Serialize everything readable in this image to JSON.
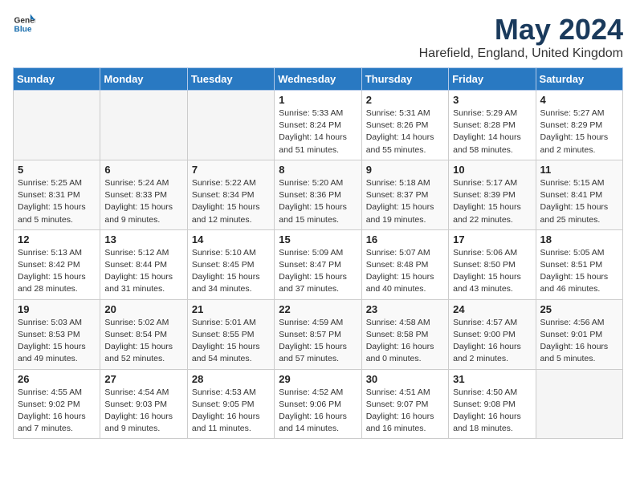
{
  "header": {
    "logo_general": "General",
    "logo_blue": "Blue",
    "month_title": "May 2024",
    "location": "Harefield, England, United Kingdom"
  },
  "weekdays": [
    "Sunday",
    "Monday",
    "Tuesday",
    "Wednesday",
    "Thursday",
    "Friday",
    "Saturday"
  ],
  "weeks": [
    [
      {
        "day": "",
        "info": ""
      },
      {
        "day": "",
        "info": ""
      },
      {
        "day": "",
        "info": ""
      },
      {
        "day": "1",
        "info": "Sunrise: 5:33 AM\nSunset: 8:24 PM\nDaylight: 14 hours\nand 51 minutes."
      },
      {
        "day": "2",
        "info": "Sunrise: 5:31 AM\nSunset: 8:26 PM\nDaylight: 14 hours\nand 55 minutes."
      },
      {
        "day": "3",
        "info": "Sunrise: 5:29 AM\nSunset: 8:28 PM\nDaylight: 14 hours\nand 58 minutes."
      },
      {
        "day": "4",
        "info": "Sunrise: 5:27 AM\nSunset: 8:29 PM\nDaylight: 15 hours\nand 2 minutes."
      }
    ],
    [
      {
        "day": "5",
        "info": "Sunrise: 5:25 AM\nSunset: 8:31 PM\nDaylight: 15 hours\nand 5 minutes."
      },
      {
        "day": "6",
        "info": "Sunrise: 5:24 AM\nSunset: 8:33 PM\nDaylight: 15 hours\nand 9 minutes."
      },
      {
        "day": "7",
        "info": "Sunrise: 5:22 AM\nSunset: 8:34 PM\nDaylight: 15 hours\nand 12 minutes."
      },
      {
        "day": "8",
        "info": "Sunrise: 5:20 AM\nSunset: 8:36 PM\nDaylight: 15 hours\nand 15 minutes."
      },
      {
        "day": "9",
        "info": "Sunrise: 5:18 AM\nSunset: 8:37 PM\nDaylight: 15 hours\nand 19 minutes."
      },
      {
        "day": "10",
        "info": "Sunrise: 5:17 AM\nSunset: 8:39 PM\nDaylight: 15 hours\nand 22 minutes."
      },
      {
        "day": "11",
        "info": "Sunrise: 5:15 AM\nSunset: 8:41 PM\nDaylight: 15 hours\nand 25 minutes."
      }
    ],
    [
      {
        "day": "12",
        "info": "Sunrise: 5:13 AM\nSunset: 8:42 PM\nDaylight: 15 hours\nand 28 minutes."
      },
      {
        "day": "13",
        "info": "Sunrise: 5:12 AM\nSunset: 8:44 PM\nDaylight: 15 hours\nand 31 minutes."
      },
      {
        "day": "14",
        "info": "Sunrise: 5:10 AM\nSunset: 8:45 PM\nDaylight: 15 hours\nand 34 minutes."
      },
      {
        "day": "15",
        "info": "Sunrise: 5:09 AM\nSunset: 8:47 PM\nDaylight: 15 hours\nand 37 minutes."
      },
      {
        "day": "16",
        "info": "Sunrise: 5:07 AM\nSunset: 8:48 PM\nDaylight: 15 hours\nand 40 minutes."
      },
      {
        "day": "17",
        "info": "Sunrise: 5:06 AM\nSunset: 8:50 PM\nDaylight: 15 hours\nand 43 minutes."
      },
      {
        "day": "18",
        "info": "Sunrise: 5:05 AM\nSunset: 8:51 PM\nDaylight: 15 hours\nand 46 minutes."
      }
    ],
    [
      {
        "day": "19",
        "info": "Sunrise: 5:03 AM\nSunset: 8:53 PM\nDaylight: 15 hours\nand 49 minutes."
      },
      {
        "day": "20",
        "info": "Sunrise: 5:02 AM\nSunset: 8:54 PM\nDaylight: 15 hours\nand 52 minutes."
      },
      {
        "day": "21",
        "info": "Sunrise: 5:01 AM\nSunset: 8:55 PM\nDaylight: 15 hours\nand 54 minutes."
      },
      {
        "day": "22",
        "info": "Sunrise: 4:59 AM\nSunset: 8:57 PM\nDaylight: 15 hours\nand 57 minutes."
      },
      {
        "day": "23",
        "info": "Sunrise: 4:58 AM\nSunset: 8:58 PM\nDaylight: 16 hours\nand 0 minutes."
      },
      {
        "day": "24",
        "info": "Sunrise: 4:57 AM\nSunset: 9:00 PM\nDaylight: 16 hours\nand 2 minutes."
      },
      {
        "day": "25",
        "info": "Sunrise: 4:56 AM\nSunset: 9:01 PM\nDaylight: 16 hours\nand 5 minutes."
      }
    ],
    [
      {
        "day": "26",
        "info": "Sunrise: 4:55 AM\nSunset: 9:02 PM\nDaylight: 16 hours\nand 7 minutes."
      },
      {
        "day": "27",
        "info": "Sunrise: 4:54 AM\nSunset: 9:03 PM\nDaylight: 16 hours\nand 9 minutes."
      },
      {
        "day": "28",
        "info": "Sunrise: 4:53 AM\nSunset: 9:05 PM\nDaylight: 16 hours\nand 11 minutes."
      },
      {
        "day": "29",
        "info": "Sunrise: 4:52 AM\nSunset: 9:06 PM\nDaylight: 16 hours\nand 14 minutes."
      },
      {
        "day": "30",
        "info": "Sunrise: 4:51 AM\nSunset: 9:07 PM\nDaylight: 16 hours\nand 16 minutes."
      },
      {
        "day": "31",
        "info": "Sunrise: 4:50 AM\nSunset: 9:08 PM\nDaylight: 16 hours\nand 18 minutes."
      },
      {
        "day": "",
        "info": ""
      }
    ]
  ]
}
